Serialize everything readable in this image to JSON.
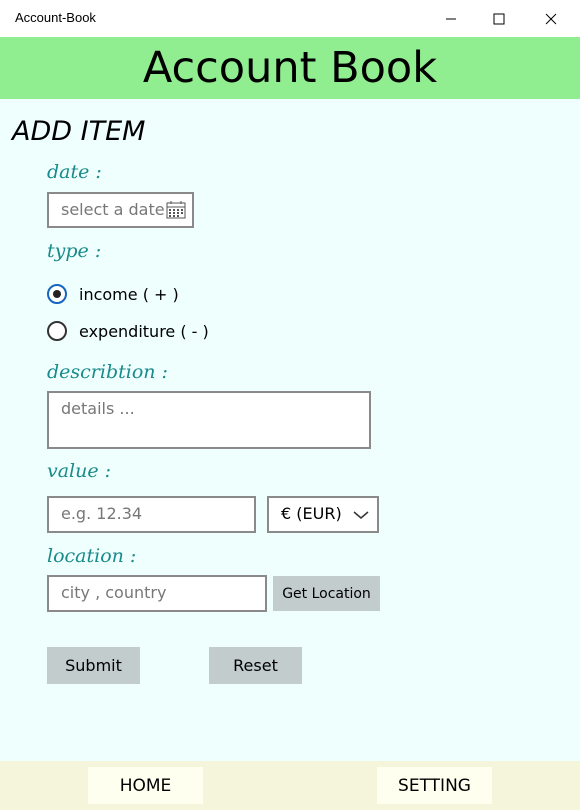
{
  "window": {
    "title": "Account-Book"
  },
  "header": {
    "title": "Account Book"
  },
  "form": {
    "section_title": "ADD ITEM",
    "date": {
      "label": "date :",
      "placeholder": "select a date",
      "icon": "calendar-icon"
    },
    "type": {
      "label": "type :",
      "options": [
        {
          "label": "income ( + )",
          "selected": true
        },
        {
          "label": "expenditure ( - )",
          "selected": false
        }
      ]
    },
    "description": {
      "label": "describtion :",
      "placeholder": "details ..."
    },
    "value": {
      "label": "value :",
      "placeholder": "e.g.  12.34",
      "currency": "€  (EUR)"
    },
    "location": {
      "label": "location :",
      "placeholder": "city , country",
      "button": "Get Location"
    },
    "submit": "Submit",
    "reset": "Reset"
  },
  "nav": {
    "home": "HOME",
    "setting": "SETTING"
  },
  "colors": {
    "header_bg": "#90ee90",
    "content_bg": "#eefffe",
    "label": "#1a8a8a",
    "button_bg": "#c3cccc",
    "footer_bg": "#f5f5dc"
  }
}
